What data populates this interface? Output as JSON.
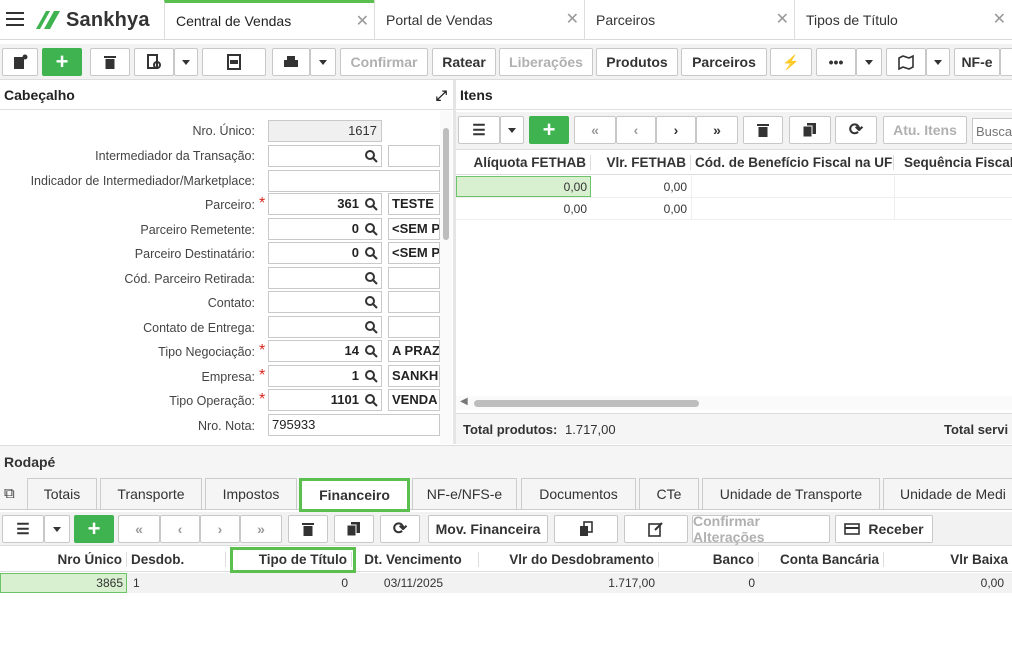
{
  "app": {
    "logo_text": "Sankhya",
    "brand_color": "#3fb34f"
  },
  "tabs": [
    {
      "label": "Central de Vendas",
      "active": true
    },
    {
      "label": "Portal de Vendas"
    },
    {
      "label": "Parceiros"
    },
    {
      "label": "Tipos de Título"
    }
  ],
  "toolbar": {
    "confirm": "Confirmar",
    "ratear": "Ratear",
    "liberacoes": "Liberações",
    "produtos": "Produtos",
    "parceiros": "Parceiros",
    "more": "•••",
    "nfe": "NF-e"
  },
  "cabecalho": {
    "title": "Cabeçalho",
    "fields": {
      "nro_unico": {
        "label": "Nro. Único:",
        "value": "1617"
      },
      "intermediador": {
        "label": "Intermediador da Transação:"
      },
      "indicador": {
        "label": "Indicador de Intermediador/Marketplace:"
      },
      "parceiro": {
        "label": "Parceiro:",
        "value": "361",
        "desc": "TESTE"
      },
      "remetente": {
        "label": "Parceiro Remetente:",
        "value": "0",
        "desc": "<SEM P"
      },
      "destinatario": {
        "label": "Parceiro Destinatário:",
        "value": "0",
        "desc": "<SEM P"
      },
      "retirada": {
        "label": "Cód. Parceiro Retirada:"
      },
      "contato": {
        "label": "Contato:"
      },
      "contato_entrega": {
        "label": "Contato de Entrega:"
      },
      "tipo_negociacao": {
        "label": "Tipo Negociação:",
        "value": "14",
        "desc": "A PRAZ"
      },
      "empresa": {
        "label": "Empresa:",
        "value": "1",
        "desc": "SANKH"
      },
      "tipo_operacao": {
        "label": "Tipo Operação:",
        "value": "1101",
        "desc": "VENDA"
      },
      "nro_nota": {
        "label": "Nro. Nota:",
        "value": "795933"
      }
    }
  },
  "itens": {
    "title": "Itens",
    "atu_itens": "Atu. Itens",
    "search_placeholder": "Busca",
    "columns": [
      "Alíquota FETHAB",
      "Vlr. FETHAB",
      "Cód. de Benefício Fiscal na UF",
      "Sequência Fiscal"
    ],
    "rows": [
      {
        "aliquota": "0,00",
        "vlr": "0,00"
      },
      {
        "aliquota": "0,00",
        "vlr": "0,00"
      }
    ],
    "total_produtos_label": "Total produtos:",
    "total_produtos_value": "1.717,00",
    "total_servicos_label": "Total servi"
  },
  "rodape": {
    "title": "Rodapé",
    "tabs": [
      "Totais",
      "Transporte",
      "Impostos",
      "Financeiro",
      "NF-e/NFS-e",
      "Documentos",
      "CTe",
      "Unidade de Transporte",
      "Unidade de Medi"
    ],
    "active_tab": "Financeiro",
    "mov_financeira": "Mov. Financeira",
    "confirmar_alteracoes": "Confirmar Alterações",
    "receber": "Receber",
    "columns": [
      "Nro Único",
      "Desdob.",
      "Tipo de Título",
      "Dt. Vencimento",
      "Vlr do Desdobramento",
      "Banco",
      "Conta Bancária",
      "Vlr Baixa"
    ],
    "row": {
      "nro_unico": "3865",
      "desdob": "1",
      "tipo_titulo": "0",
      "dt_venc": "03/11/2025",
      "vlr_desdob": "1.717,00",
      "banco": "0",
      "conta": "",
      "vlr_baixa": "0,00"
    }
  }
}
